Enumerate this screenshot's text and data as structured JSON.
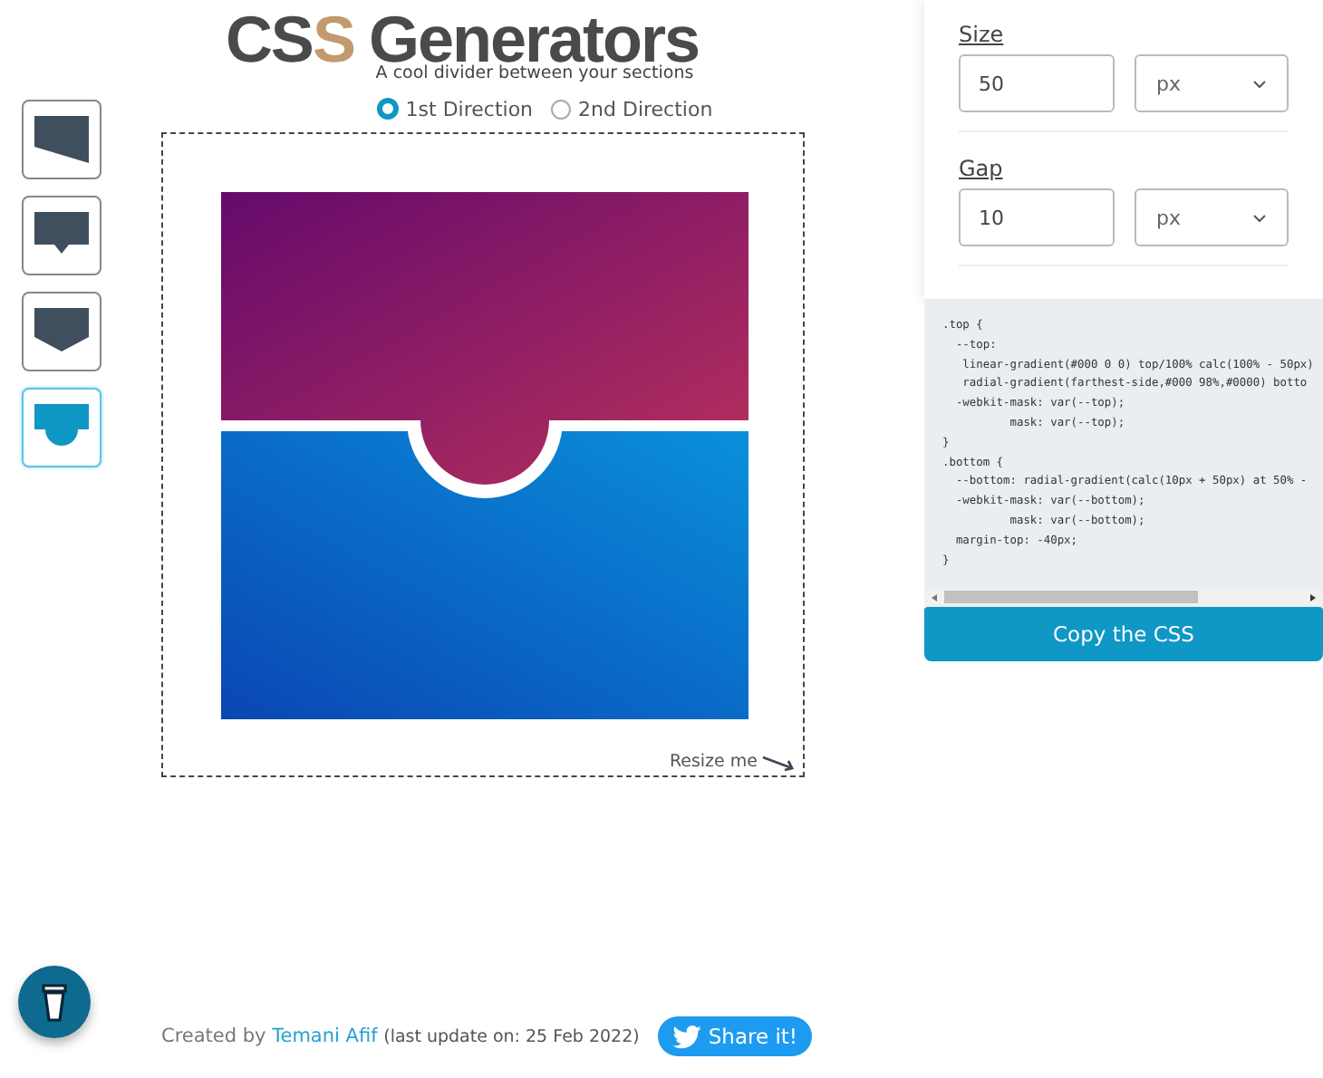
{
  "logo": {
    "title_a": "CS",
    "title_b": "S",
    "title_c": "Generators",
    "tagline": "A cool divider between your sections"
  },
  "shapes": [
    {
      "kind": "slant",
      "selected": false
    },
    {
      "kind": "arrow",
      "selected": false
    },
    {
      "kind": "chevron",
      "selected": false
    },
    {
      "kind": "curve",
      "selected": true
    }
  ],
  "directions": [
    {
      "label": "1st Direction",
      "selected": true
    },
    {
      "label": "2nd Direction",
      "selected": false
    }
  ],
  "resize_label": "Resize me",
  "settings": [
    {
      "label": "Size",
      "value": "50",
      "unit": "px"
    },
    {
      "label": "Gap",
      "value": "10",
      "unit": "px"
    }
  ],
  "code_lines": [
    ".top {",
    "  --top:",
    "   linear-gradient(#000 0 0) top/100% calc(100% - 50px)",
    "   radial-gradient(farthest-side,#000 98%,#0000) botto",
    "  -webkit-mask: var(--top);",
    "          mask: var(--top);",
    "}",
    ".bottom {",
    "  --bottom: radial-gradient(calc(10px + 50px) at 50% -",
    "  -webkit-mask: var(--bottom);",
    "          mask: var(--bottom);",
    "  margin-top: -40px;",
    "}"
  ],
  "copy_button": "Copy the CSS",
  "footer": {
    "created_by": "Created by",
    "author": "Temani Afif",
    "update": "(last update on: 25 Feb 2022)",
    "share": "Share it!"
  }
}
